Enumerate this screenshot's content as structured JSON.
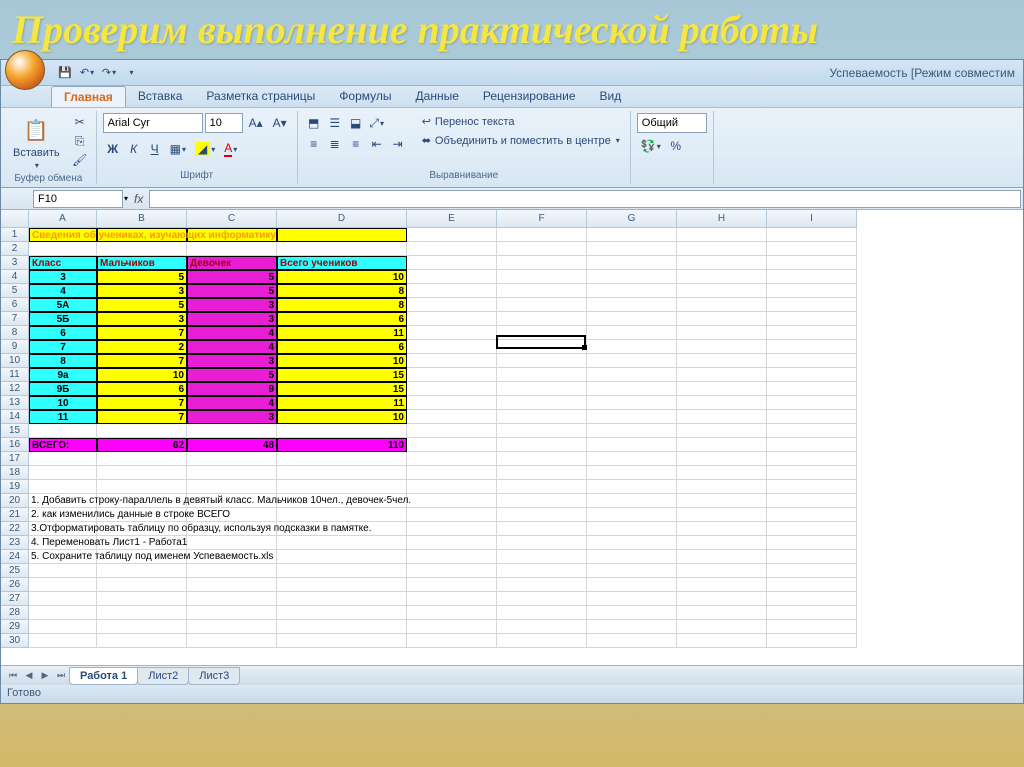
{
  "slide_title": "Проверим выполнение практической работы",
  "window_title": "Успеваемость  [Режим совместим",
  "ribbon": {
    "tabs": [
      "Главная",
      "Вставка",
      "Разметка страницы",
      "Формулы",
      "Данные",
      "Рецензирование",
      "Вид"
    ],
    "active_tab": 0,
    "clipboard": {
      "label": "Буфер обмена",
      "paste": "Вставить"
    },
    "font": {
      "label": "Шрифт",
      "name": "Arial Cyr",
      "size": "10",
      "bold": "Ж",
      "italic": "К",
      "underline": "Ч"
    },
    "alignment": {
      "label": "Выравнивание",
      "wrap": "Перенос текста",
      "merge": "Объединить и поместить в центре"
    },
    "number": {
      "format": "Общий"
    }
  },
  "namebox": "F10",
  "columns": [
    {
      "letter": "A",
      "width": 68
    },
    {
      "letter": "B",
      "width": 90
    },
    {
      "letter": "C",
      "width": 90
    },
    {
      "letter": "D",
      "width": 130
    },
    {
      "letter": "E",
      "width": 90
    },
    {
      "letter": "F",
      "width": 90
    },
    {
      "letter": "G",
      "width": 90
    },
    {
      "letter": "H",
      "width": 90
    },
    {
      "letter": "I",
      "width": 90
    }
  ],
  "row_count": 30,
  "active": {
    "col": 5,
    "row": 10
  },
  "colors": {
    "cyan": "#2fffff",
    "yellow": "#ffff00",
    "magenta": "#e81ed4",
    "magenta2": "#ff00ff",
    "title_text": "#ff9a00"
  },
  "table": {
    "title": "Сведения об учениках, изучающих информатику",
    "headers": [
      "Класс",
      "Мальчиков",
      "Девочек",
      "Всего учеников"
    ],
    "rows": [
      [
        "3",
        "5",
        "5",
        "10"
      ],
      [
        "4",
        "3",
        "5",
        "8"
      ],
      [
        "5А",
        "5",
        "3",
        "8"
      ],
      [
        "5Б",
        "3",
        "3",
        "6"
      ],
      [
        "6",
        "7",
        "4",
        "11"
      ],
      [
        "7",
        "2",
        "4",
        "6"
      ],
      [
        "8",
        "7",
        "3",
        "10"
      ],
      [
        "9а",
        "10",
        "5",
        "15"
      ],
      [
        "9Б",
        "6",
        "9",
        "15"
      ],
      [
        "10",
        "7",
        "4",
        "11"
      ],
      [
        "11",
        "7",
        "3",
        "10"
      ]
    ],
    "total_label": "ВСЕГО:",
    "totals": [
      "62",
      "48",
      "110"
    ]
  },
  "instructions": [
    "1. Добавить строку-параллель в девятый  класс. Мальчиков 10чел., девочек-5чел.",
    "2. как изменились данные в строке ВСЕГО",
    "3.Отформатировать таблицу по образцу, используя подсказки в памятке.",
    "4. Переменовать Лист1 -  Работа1",
    "5.   Сохраните таблицу под именем Успеваемость.xls"
  ],
  "sheets": [
    "Работа 1",
    "Лист2",
    "Лист3"
  ],
  "active_sheet": 0,
  "status": "Готово"
}
